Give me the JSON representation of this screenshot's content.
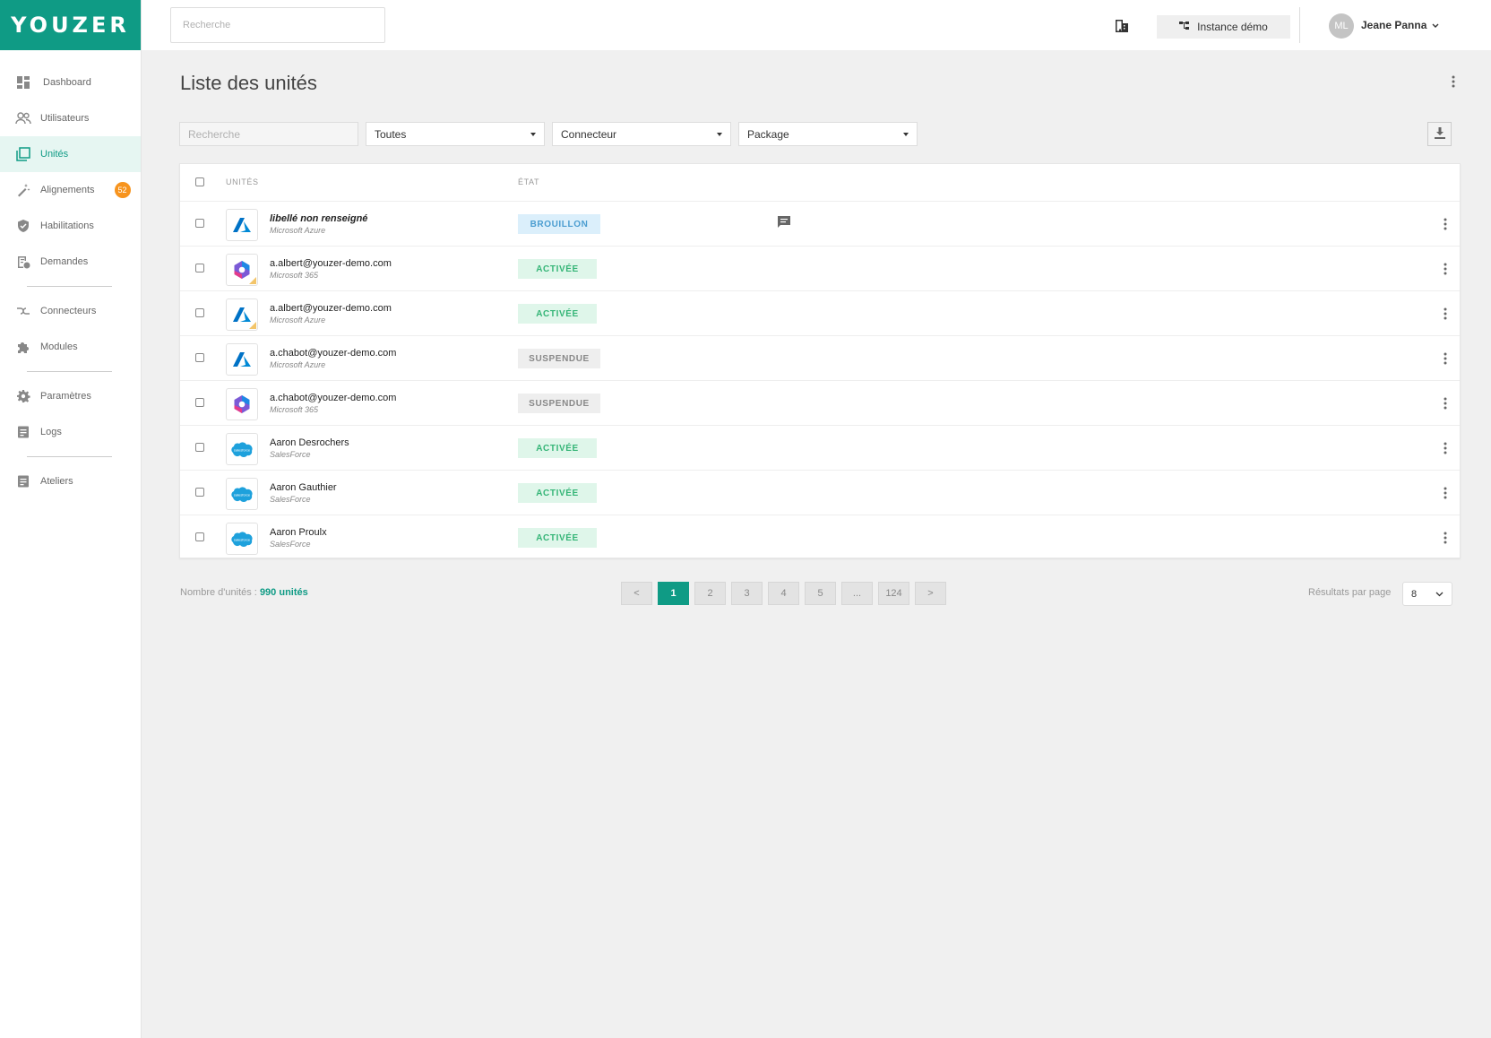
{
  "app": {
    "logo": "YOUZER"
  },
  "topbar": {
    "search_placeholder": "Recherche",
    "instance_label": "Instance démo",
    "user_initials": "ML",
    "user_name": "Jeane Panna"
  },
  "sidebar": {
    "items": [
      {
        "label": "Dashboard",
        "icon": "dashboard-icon"
      },
      {
        "label": "Utilisateurs",
        "icon": "users-icon"
      },
      {
        "label": "Unités",
        "icon": "units-icon",
        "active": true
      },
      {
        "label": "Alignements",
        "icon": "magic-wand-icon",
        "badge": "52"
      },
      {
        "label": "Habilitations",
        "icon": "shield-icon"
      },
      {
        "label": "Demandes",
        "icon": "request-icon"
      },
      {
        "label": "Connecteurs",
        "icon": "connector-icon"
      },
      {
        "label": "Modules",
        "icon": "puzzle-icon"
      },
      {
        "label": "Paramètres",
        "icon": "gear-icon"
      },
      {
        "label": "Logs",
        "icon": "logs-icon"
      },
      {
        "label": "Ateliers",
        "icon": "workshop-icon"
      }
    ]
  },
  "page": {
    "title": "Liste des unités"
  },
  "filters": {
    "search_placeholder": "Recherche",
    "status_select": "Toutes",
    "connector_select": "Connecteur",
    "package_select": "Package"
  },
  "table": {
    "headers": {
      "units": "UNITÉS",
      "state": "ÉTAT"
    },
    "rows": [
      {
        "name": "libellé non renseigné",
        "subtitle": "Microsoft Azure",
        "logo": "azure",
        "status": "BROUILLON",
        "status_type": "brouillon",
        "has_comment": true
      },
      {
        "name": "a.albert@youzer-demo.com",
        "subtitle": "Microsoft 365",
        "logo": "m365",
        "status": "ACTIVÉE",
        "status_type": "activee",
        "has_comment": false
      },
      {
        "name": "a.albert@youzer-demo.com",
        "subtitle": "Microsoft Azure",
        "logo": "azure",
        "status": "ACTIVÉE",
        "status_type": "activee",
        "has_comment": false
      },
      {
        "name": "a.chabot@youzer-demo.com",
        "subtitle": "Microsoft Azure",
        "logo": "azure",
        "status": "SUSPENDUE",
        "status_type": "suspendue",
        "has_comment": false
      },
      {
        "name": "a.chabot@youzer-demo.com",
        "subtitle": "Microsoft 365",
        "logo": "m365",
        "status": "SUSPENDUE",
        "status_type": "suspendue",
        "has_comment": false
      },
      {
        "name": "Aaron Desrochers",
        "subtitle": "SalesForce",
        "logo": "salesforce",
        "status": "ACTIVÉE",
        "status_type": "activee",
        "has_comment": false
      },
      {
        "name": "Aaron Gauthier",
        "subtitle": "SalesForce",
        "logo": "salesforce",
        "status": "ACTIVÉE",
        "status_type": "activee",
        "has_comment": false
      },
      {
        "name": "Aaron Proulx",
        "subtitle": "SalesForce",
        "logo": "salesforce",
        "status": "ACTIVÉE",
        "status_type": "activee",
        "has_comment": false
      }
    ]
  },
  "footer": {
    "count_label": "Nombre d'unités :",
    "count_value": "990 unités",
    "pages": [
      "<",
      "1",
      "2",
      "3",
      "4",
      "5",
      "...",
      "124",
      ">"
    ],
    "active_page": "1",
    "rpp_label": "Résultats par page",
    "rpp_value": "8"
  },
  "colors": {
    "brand": "#0f9b85",
    "badge": "#f7941e"
  }
}
